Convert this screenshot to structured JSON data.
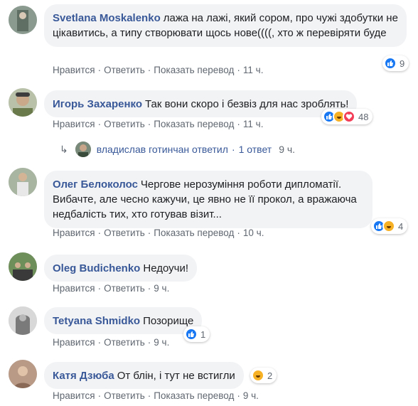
{
  "actions": {
    "like": "Нравится",
    "reply": "Ответить",
    "translate": "Показать перевод",
    "sep": "·"
  },
  "comments": [
    {
      "author": "Svetlana Moskalenko",
      "text": "лажа на лажі, який сором, про чужі здобутки не цікавитись, а типу створювати щось нове((((, хто ж перевіряти буде",
      "time": "11 ч.",
      "reactions": "9",
      "reaction_icons": [
        "like-icon"
      ]
    },
    {
      "author": "Игорь Захаренко",
      "text": "Так вони скоро і безвіз для нас зроблять!",
      "time": "11 ч.",
      "reactions": "48",
      "reaction_icons": [
        "like-icon",
        "haha-icon",
        "love-icon"
      ]
    },
    {
      "author": "Олег Белоколос",
      "text": "Чергове нерозуміння роботи дипломатії. Вибачте, але чесно кажучи, це явно не її прокол, а вражаюча недбалість тих, хто готував візит...",
      "time": "10 ч.",
      "reactions": "4",
      "reaction_icons": [
        "like-icon",
        "haha-icon"
      ]
    },
    {
      "author": "Oleg Budichenko",
      "text": "Недоучи!",
      "time": "9 ч."
    },
    {
      "author": "Tetyana Shmidko",
      "text": "Позорище",
      "time": "9 ч.",
      "reactions": "1",
      "reaction_icons": [
        "like-icon"
      ]
    },
    {
      "author": "Катя Дзюба",
      "text": "От блін, і тут не встигли",
      "time": "9 ч.",
      "reactions": "2",
      "reaction_icons": [
        "haha-icon"
      ]
    }
  ],
  "reply_summary": {
    "arrow": "↳",
    "author": "владислав готинчан",
    "action": "ответил",
    "dot": "·",
    "count": "1 ответ",
    "time": "9 ч."
  },
  "colors": {
    "link": "#385898",
    "bubble": "#f2f3f5",
    "meta": "#606770",
    "like": "#1877f2",
    "haha": "#f7b125",
    "love": "#f33e58"
  }
}
